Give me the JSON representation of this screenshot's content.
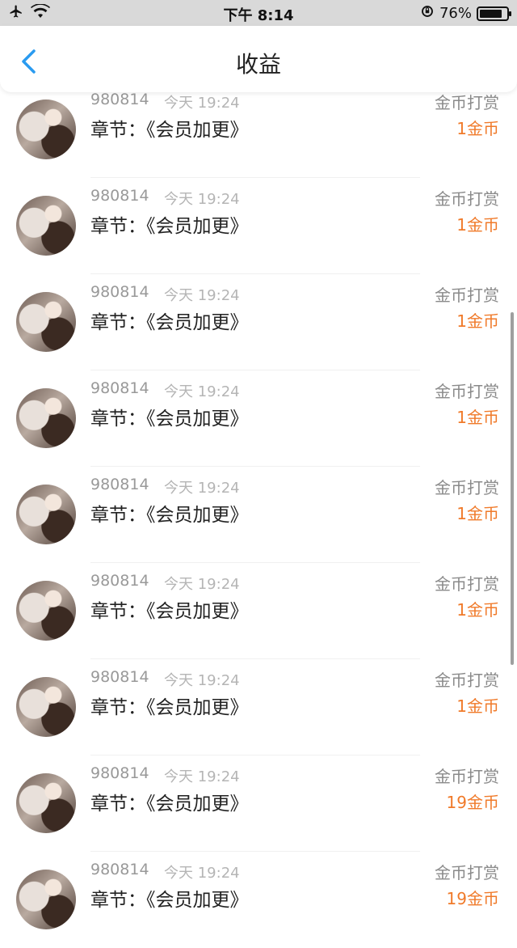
{
  "status_bar": {
    "time": "下午 8:14",
    "battery_percent": "76%",
    "battery_level": 0.76
  },
  "nav": {
    "title": "收益"
  },
  "items": [
    {
      "uid": "980814",
      "time": "今天 19:24",
      "chapter": "章节：《会员加更》",
      "type": "金币打赏",
      "amount": "1金币"
    },
    {
      "uid": "980814",
      "time": "今天 19:24",
      "chapter": "章节：《会员加更》",
      "type": "金币打赏",
      "amount": "1金币"
    },
    {
      "uid": "980814",
      "time": "今天 19:24",
      "chapter": "章节：《会员加更》",
      "type": "金币打赏",
      "amount": "1金币"
    },
    {
      "uid": "980814",
      "time": "今天 19:24",
      "chapter": "章节：《会员加更》",
      "type": "金币打赏",
      "amount": "1金币"
    },
    {
      "uid": "980814",
      "time": "今天 19:24",
      "chapter": "章节：《会员加更》",
      "type": "金币打赏",
      "amount": "1金币"
    },
    {
      "uid": "980814",
      "time": "今天 19:24",
      "chapter": "章节：《会员加更》",
      "type": "金币打赏",
      "amount": "1金币"
    },
    {
      "uid": "980814",
      "time": "今天 19:24",
      "chapter": "章节：《会员加更》",
      "type": "金币打赏",
      "amount": "1金币"
    },
    {
      "uid": "980814",
      "time": "今天 19:24",
      "chapter": "章节：《会员加更》",
      "type": "金币打赏",
      "amount": "19金币"
    },
    {
      "uid": "980814",
      "time": "今天 19:24",
      "chapter": "章节：《会员加更》",
      "type": "金币打赏",
      "amount": "19金币"
    }
  ],
  "colors": {
    "accent_blue": "#2a9bf0",
    "amount_orange": "#f07a2a"
  }
}
